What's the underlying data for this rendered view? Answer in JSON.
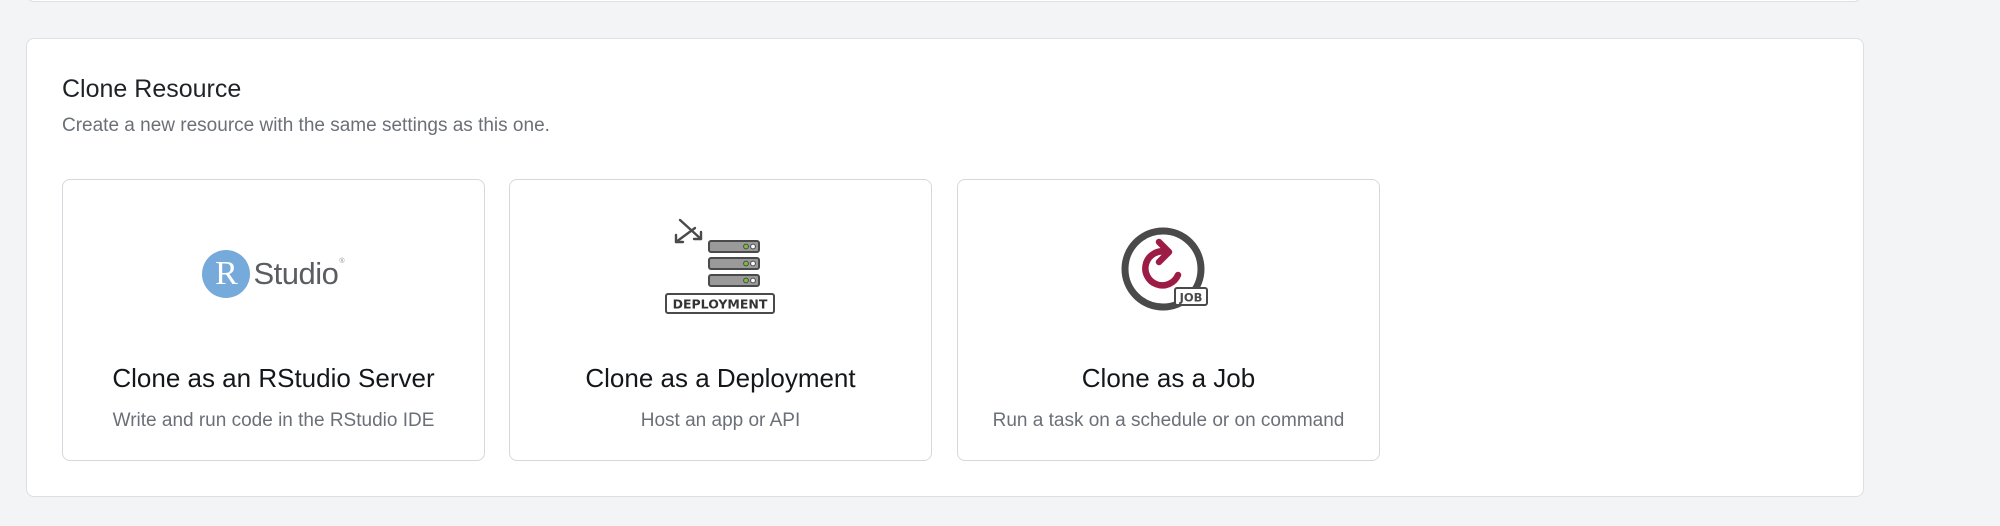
{
  "section": {
    "title": "Clone Resource",
    "description": "Create a new resource with the same settings as this one."
  },
  "cards": [
    {
      "logo_text_r": "R",
      "logo_text_word": "Studio",
      "logo_reg": "®",
      "title": "Clone as an RStudio Server",
      "description": "Write and run code in the RStudio IDE",
      "icon": "rstudio-logo"
    },
    {
      "logo_label": "DEPLOYMENT",
      "title": "Clone as a Deployment",
      "description": "Host an app or API",
      "icon": "deployment-server-icon"
    },
    {
      "logo_label": "JOB",
      "title": "Clone as a Job",
      "description": "Run a task on a schedule or on command",
      "icon": "job-refresh-icon"
    }
  ],
  "colors": {
    "rstudio_blue": "#75aadb",
    "job_accent": "#9c1c45",
    "icon_gray": "#4a4a4a",
    "led_green": "#7bbf3a"
  }
}
